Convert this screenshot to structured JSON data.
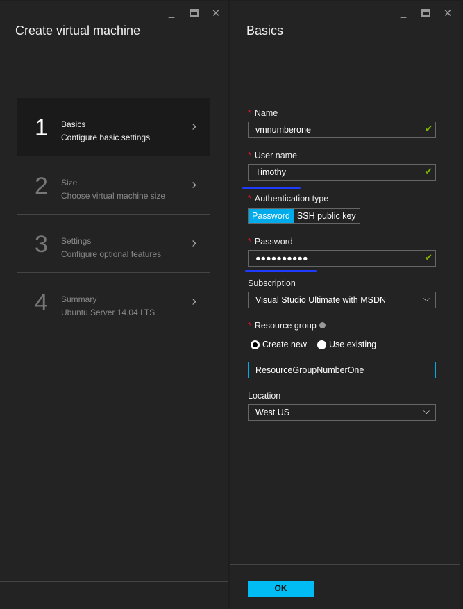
{
  "left": {
    "title": "Create virtual machine",
    "steps": [
      {
        "num": "1",
        "title": "Basics",
        "subtitle": "Configure basic settings"
      },
      {
        "num": "2",
        "title": "Size",
        "subtitle": "Choose virtual machine size"
      },
      {
        "num": "3",
        "title": "Settings",
        "subtitle": "Configure optional features"
      },
      {
        "num": "4",
        "title": "Summary",
        "subtitle": "Ubuntu Server 14.04 LTS"
      }
    ]
  },
  "right": {
    "title": "Basics",
    "name_label": "Name",
    "name_value": "vmnumberone",
    "user_label": "User name",
    "user_value": "Timothy",
    "auth_label": "Authentication type",
    "auth_options": [
      "Password",
      "SSH public key"
    ],
    "password_label": "Password",
    "password_value": "●●●●●●●●●●",
    "subscription_label": "Subscription",
    "subscription_value": "Visual Studio Ultimate with MSDN",
    "rg_label": "Resource group",
    "rg_create": "Create new",
    "rg_existing": "Use existing",
    "rg_value": "ResourceGroupNumberOne",
    "location_label": "Location",
    "location_value": "West US",
    "ok": "OK"
  },
  "colors": {
    "accent": "#00bcf2",
    "valid": "#7fba00",
    "required": "#e81123"
  }
}
